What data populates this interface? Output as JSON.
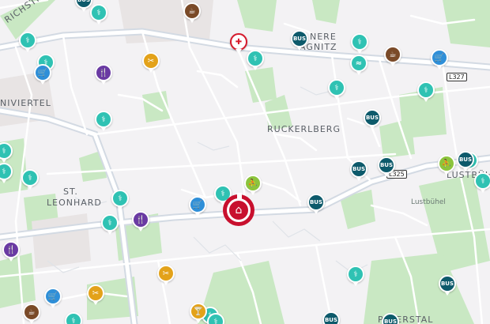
{
  "map": {
    "labels": {
      "strasse": "RICHSTRASSE",
      "viertel": "NIVIERTEL",
      "ruckerlberg": "RUCKERLBERG",
      "st_leonhard_1": "ST.",
      "st_leonhard_2": "LEONHARD",
      "innere_1": "NERE",
      "innere_2": "AGNITZ",
      "lustbuhel_area": "LUSTBÜH",
      "lustbuhel_park": "Lustbühel",
      "peterstal": "PETERSTAL"
    },
    "road_shields": {
      "l327": "L327",
      "l325": "L325"
    },
    "bus_text": "BUS",
    "colors": {
      "doctor": "#2fc2b3",
      "bus": "#0d5a6b",
      "shop": "#2f8fd8",
      "cafe": "#7a4a28",
      "restaurant": "#6a3aa3",
      "hairdresser": "#e3a21a",
      "pharmacy": "#d6192b",
      "playground": "#8cc43c",
      "home": "#c8102e",
      "park": "#c9e8c3",
      "road": "#ffffff",
      "road_major": "#d8dee6"
    },
    "icons": {
      "doctor": "stethoscope-icon",
      "bus": "bus-icon",
      "shop": "shopping-cart-icon",
      "cafe": "coffee-cup-icon",
      "restaurant": "fork-knife-icon",
      "hairdresser": "hairdryer-icon",
      "pharmacy": "pharmacy-icon",
      "playground": "playground-icon",
      "swimming": "swimmer-icon",
      "bar": "cocktail-icon",
      "home": "house-icon"
    }
  }
}
